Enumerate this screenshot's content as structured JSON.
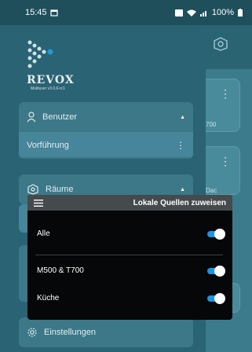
{
  "status": {
    "time": "15:45",
    "battery": "100%"
  },
  "background": {
    "card1_label": "700",
    "card2_label": "Dac"
  },
  "drawer": {
    "logo_text": "REVOX",
    "logo_version": "Multiuser v3.0.6-rc1",
    "sections": [
      {
        "label": "Benutzer",
        "items": [
          "Vorführung"
        ]
      },
      {
        "label": "Räume",
        "items": []
      },
      {
        "label": "Einstellungen",
        "items": []
      }
    ]
  },
  "dialog": {
    "title": "Lokale Quellen zuweisen",
    "rows": [
      {
        "label": "Alle",
        "on": true
      },
      {
        "label": "M500 & T700",
        "on": true
      },
      {
        "label": "Küche",
        "on": true
      }
    ]
  }
}
